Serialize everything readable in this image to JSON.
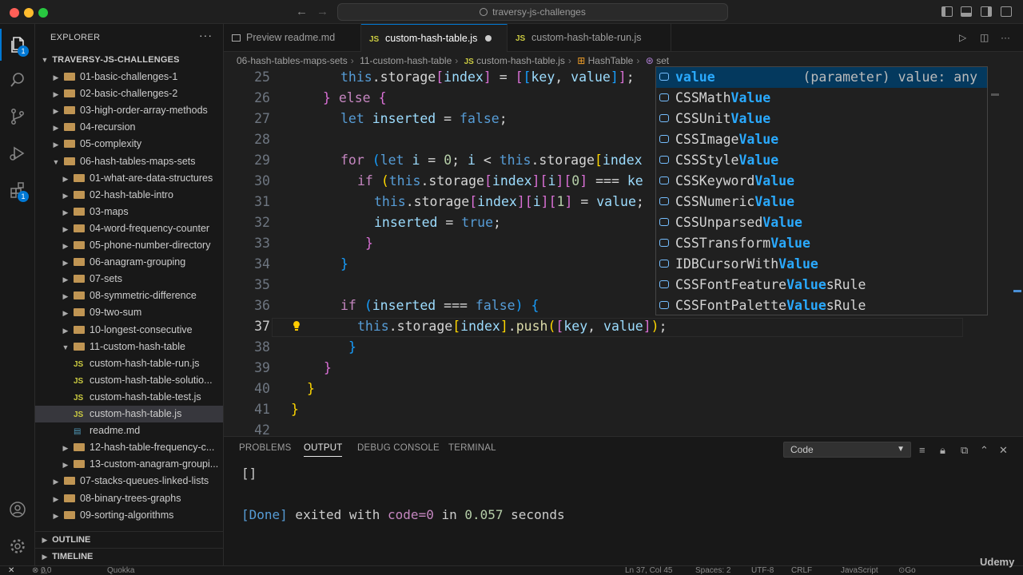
{
  "titlebar": {
    "search": "traversy-js-challenges",
    "back_arrow": "←",
    "forward_arrow": "→"
  },
  "activity": {
    "explorer_badge": "1",
    "extensions_badge": "1"
  },
  "sidebar": {
    "title": "EXPLORER",
    "more": "···",
    "root": "TRAVERSY-JS-CHALLENGES",
    "items": [
      {
        "label": "01-basic-challenges-1",
        "type": "folder",
        "depth": 1
      },
      {
        "label": "02-basic-challenges-2",
        "type": "folder",
        "depth": 1
      },
      {
        "label": "03-high-order-array-methods",
        "type": "folder",
        "depth": 1
      },
      {
        "label": "04-recursion",
        "type": "folder",
        "depth": 1
      },
      {
        "label": "05-complexity",
        "type": "folder",
        "depth": 1
      },
      {
        "label": "06-hash-tables-maps-sets",
        "type": "folder-open",
        "depth": 1
      },
      {
        "label": "01-what-are-data-structures",
        "type": "folder",
        "depth": 2
      },
      {
        "label": "02-hash-table-intro",
        "type": "folder",
        "depth": 2
      },
      {
        "label": "03-maps",
        "type": "folder",
        "depth": 2
      },
      {
        "label": "04-word-frequency-counter",
        "type": "folder",
        "depth": 2
      },
      {
        "label": "05-phone-number-directory",
        "type": "folder",
        "depth": 2
      },
      {
        "label": "06-anagram-grouping",
        "type": "folder",
        "depth": 2
      },
      {
        "label": "07-sets",
        "type": "folder",
        "depth": 2
      },
      {
        "label": "08-symmetric-difference",
        "type": "folder",
        "depth": 2
      },
      {
        "label": "09-two-sum",
        "type": "folder",
        "depth": 2
      },
      {
        "label": "10-longest-consecutive",
        "type": "folder",
        "depth": 2
      },
      {
        "label": "11-custom-hash-table",
        "type": "folder-open",
        "depth": 2
      },
      {
        "label": "custom-hash-table-run.js",
        "type": "js",
        "depth": 3
      },
      {
        "label": "custom-hash-table-solutio...",
        "type": "js",
        "depth": 3
      },
      {
        "label": "custom-hash-table-test.js",
        "type": "js",
        "depth": 3
      },
      {
        "label": "custom-hash-table.js",
        "type": "js",
        "depth": 3,
        "selected": true
      },
      {
        "label": "readme.md",
        "type": "md",
        "depth": 3
      },
      {
        "label": "12-hash-table-frequency-c...",
        "type": "folder",
        "depth": 2
      },
      {
        "label": "13-custom-anagram-groupi...",
        "type": "folder",
        "depth": 2
      },
      {
        "label": "07-stacks-queues-linked-lists",
        "type": "folder",
        "depth": 1
      },
      {
        "label": "08-binary-trees-graphs",
        "type": "folder",
        "depth": 1
      },
      {
        "label": "09-sorting-algorithms",
        "type": "folder",
        "depth": 1
      }
    ],
    "outline": "OUTLINE",
    "timeline": "TIMELINE"
  },
  "tabs": [
    {
      "label": "Preview readme.md",
      "icon": "preview-icon"
    },
    {
      "label": "custom-hash-table.js",
      "icon": "JS",
      "active": true,
      "dirty": true
    },
    {
      "label": "custom-hash-table-run.js",
      "icon": "JS"
    }
  ],
  "breadcrumb": [
    "06-hash-tables-maps-sets",
    "11-custom-hash-table",
    "custom-hash-table.js",
    "HashTable",
    "set"
  ],
  "editor": {
    "line_numbers": [
      "25",
      "26",
      "27",
      "28",
      "29",
      "30",
      "31",
      "32",
      "33",
      "34",
      "35",
      "36",
      "37",
      "38",
      "39",
      "40",
      "41",
      "42"
    ],
    "current_line": "37"
  },
  "suggest": {
    "detail": "(parameter) value: any",
    "items": [
      {
        "pre": "",
        "match": "value",
        "post": ""
      },
      {
        "pre": "CSSMath",
        "match": "Value",
        "post": ""
      },
      {
        "pre": "CSSUnit",
        "match": "Value",
        "post": ""
      },
      {
        "pre": "CSSImage",
        "match": "Value",
        "post": ""
      },
      {
        "pre": "CSSStyle",
        "match": "Value",
        "post": ""
      },
      {
        "pre": "CSSKeyword",
        "match": "Value",
        "post": ""
      },
      {
        "pre": "CSSNumeric",
        "match": "Value",
        "post": ""
      },
      {
        "pre": "CSSUnparsed",
        "match": "Value",
        "post": ""
      },
      {
        "pre": "CSSTransform",
        "match": "Value",
        "post": ""
      },
      {
        "pre": "IDBCursorWith",
        "match": "Value",
        "post": ""
      },
      {
        "pre": "CSSFontFeature",
        "match": "Value",
        "post": "sRule"
      },
      {
        "pre": "CSSFontPalette",
        "match": "Value",
        "post": "sRule"
      }
    ]
  },
  "panel": {
    "tabs": [
      "PROBLEMS",
      "OUTPUT",
      "DEBUG CONSOLE",
      "TERMINAL"
    ],
    "active_tab": "OUTPUT",
    "channel": "Code",
    "output_line1": "[]",
    "output_done": "[Done]",
    "output_text1": " exited with ",
    "output_code": "code=0",
    "output_text2": " in ",
    "output_time": "0.057",
    "output_text3": " seconds"
  },
  "statusbar": {
    "errors": "0",
    "warnings": "0",
    "quokka": "Quokka",
    "position": "Ln 37, Col 45",
    "spaces": "Spaces: 2",
    "encoding": "UTF-8",
    "eol": "CRLF",
    "language": "JavaScript",
    "golive": "Go Live"
  },
  "watermark": "Udemy",
  "colors": {
    "accent": "#0078d4",
    "folder": "#c09553",
    "js": "#cbcb41",
    "match": "#2aaaff"
  }
}
